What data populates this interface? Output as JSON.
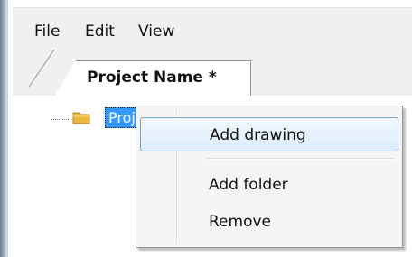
{
  "menubar": {
    "items": [
      {
        "label": "File"
      },
      {
        "label": "Edit"
      },
      {
        "label": "View"
      }
    ]
  },
  "tabs": [
    {
      "label": "Project Name *",
      "active": true
    }
  ],
  "tree": {
    "nodes": [
      {
        "label": "Proje",
        "icon": "folder-icon",
        "selected": true
      }
    ]
  },
  "context_menu": {
    "items": [
      {
        "label": "Add drawing",
        "highlighted": true
      },
      {
        "label": "Add folder"
      },
      {
        "label": "Remove"
      }
    ]
  },
  "colors": {
    "selection": "#3399ff",
    "menu_highlight_border": "#7da2ce",
    "folder": "#e8b93a"
  }
}
